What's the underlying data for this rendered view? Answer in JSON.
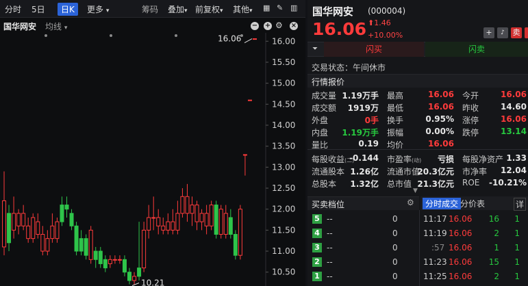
{
  "toolbar": {
    "tabs": [
      "分时",
      "5日",
      "日K",
      "更多"
    ],
    "right": [
      "筹码",
      "叠加",
      "前复权",
      "其他"
    ]
  },
  "chart_header": {
    "stock": "国华网安",
    "ma": "均线"
  },
  "chart_data": {
    "type": "candlestick",
    "yticks": [
      "16.00",
      "15.50",
      "15.00",
      "14.50",
      "14.00",
      "13.50",
      "13.00",
      "12.50",
      "12.00",
      "11.50",
      "11.00",
      "10.50"
    ],
    "ylim": [
      10.3,
      16.2
    ],
    "annotations": {
      "high": "16.06",
      "low": "10.21"
    },
    "candles": [
      {
        "o": 12.2,
        "c": 11.1,
        "h": 12.9,
        "l": 10.9,
        "d": "down"
      },
      {
        "o": 11.2,
        "c": 11.9,
        "h": 12.1,
        "l": 11.0,
        "d": "up"
      },
      {
        "o": 11.9,
        "c": 11.5,
        "h": 12.3,
        "l": 11.3,
        "d": "down"
      },
      {
        "o": 11.6,
        "c": 11.9,
        "h": 12.0,
        "l": 11.4,
        "d": "down"
      },
      {
        "o": 11.9,
        "c": 11.6,
        "h": 12.1,
        "l": 11.5,
        "d": "down"
      },
      {
        "o": 11.6,
        "c": 11.3,
        "h": 11.8,
        "l": 11.2,
        "d": "down"
      },
      {
        "o": 11.3,
        "c": 11.8,
        "h": 11.9,
        "l": 11.2,
        "d": "down"
      },
      {
        "o": 11.7,
        "c": 11.4,
        "h": 11.9,
        "l": 11.3,
        "d": "down"
      },
      {
        "o": 11.4,
        "c": 11.0,
        "h": 11.6,
        "l": 10.9,
        "d": "down"
      },
      {
        "o": 11.0,
        "c": 11.3,
        "h": 11.5,
        "l": 10.9,
        "d": "down"
      },
      {
        "o": 11.6,
        "c": 11.3,
        "h": 11.9,
        "l": 11.2,
        "d": "down"
      },
      {
        "o": 11.3,
        "c": 11.7,
        "h": 11.8,
        "l": 11.2,
        "d": "down"
      },
      {
        "o": 11.7,
        "c": 12.1,
        "h": 12.3,
        "l": 11.6,
        "d": "up"
      },
      {
        "o": 12.1,
        "c": 12.0,
        "h": 12.3,
        "l": 11.8,
        "d": "up"
      },
      {
        "o": 11.9,
        "c": 11.6,
        "h": 12.0,
        "l": 11.5,
        "d": "up"
      },
      {
        "o": 11.6,
        "c": 11.0,
        "h": 11.7,
        "l": 10.9,
        "d": "up"
      },
      {
        "o": 11.0,
        "c": 11.3,
        "h": 11.5,
        "l": 10.9,
        "d": "up"
      },
      {
        "o": 11.3,
        "c": 10.9,
        "h": 11.4,
        "l": 10.8,
        "d": "up"
      },
      {
        "o": 11.5,
        "c": 10.8,
        "h": 11.6,
        "l": 10.7,
        "d": "down"
      },
      {
        "o": 10.8,
        "c": 11.0,
        "h": 11.1,
        "l": 10.6,
        "d": "up"
      },
      {
        "o": 11.0,
        "c": 10.7,
        "h": 11.1,
        "l": 10.6,
        "d": "up"
      },
      {
        "o": 10.6,
        "c": 10.8,
        "h": 10.9,
        "l": 10.5,
        "d": "up"
      },
      {
        "o": 10.8,
        "c": 10.7,
        "h": 10.9,
        "l": 10.6,
        "d": "down"
      },
      {
        "o": 10.8,
        "c": 10.8,
        "h": 10.9,
        "l": 10.7,
        "d": "down"
      },
      {
        "o": 10.8,
        "c": 10.8,
        "h": 10.9,
        "l": 10.7,
        "d": "down"
      },
      {
        "o": 10.8,
        "c": 10.5,
        "h": 10.9,
        "l": 10.4,
        "d": "up"
      },
      {
        "o": 10.5,
        "c": 10.3,
        "h": 10.6,
        "l": 10.21,
        "d": "up"
      },
      {
        "o": 10.3,
        "c": 10.4,
        "h": 10.5,
        "l": 10.2,
        "d": "down"
      },
      {
        "o": 10.4,
        "c": 10.6,
        "h": 11.7,
        "l": 10.3,
        "d": "up"
      },
      {
        "o": 10.6,
        "c": 11.5,
        "h": 11.7,
        "l": 10.5,
        "d": "down"
      },
      {
        "o": 11.5,
        "c": 11.8,
        "h": 12.1,
        "l": 11.3,
        "d": "down"
      },
      {
        "o": 11.8,
        "c": 11.8,
        "h": 12.3,
        "l": 11.5,
        "d": "down"
      },
      {
        "o": 11.8,
        "c": 11.6,
        "h": 12.0,
        "l": 11.4,
        "d": "down"
      },
      {
        "o": 11.6,
        "c": 11.5,
        "h": 11.8,
        "l": 11.4,
        "d": "down"
      },
      {
        "o": 11.5,
        "c": 11.7,
        "h": 11.9,
        "l": 11.4,
        "d": "down"
      },
      {
        "o": 11.7,
        "c": 11.5,
        "h": 12.0,
        "l": 11.4,
        "d": "down"
      },
      {
        "o": 11.5,
        "c": 11.9,
        "h": 12.2,
        "l": 11.4,
        "d": "down"
      },
      {
        "o": 11.9,
        "c": 12.3,
        "h": 12.5,
        "l": 11.8,
        "d": "down"
      },
      {
        "o": 12.3,
        "c": 11.9,
        "h": 12.6,
        "l": 11.7,
        "d": "down"
      },
      {
        "o": 11.9,
        "c": 12.1,
        "h": 12.3,
        "l": 11.6,
        "d": "down"
      },
      {
        "o": 12.1,
        "c": 11.7,
        "h": 12.2,
        "l": 11.5,
        "d": "down"
      },
      {
        "o": 11.7,
        "c": 11.9,
        "h": 12.0,
        "l": 11.5,
        "d": "down"
      },
      {
        "o": 11.9,
        "c": 11.6,
        "h": 12.1,
        "l": 11.4,
        "d": "down"
      },
      {
        "o": 11.6,
        "c": 12.1,
        "h": 12.2,
        "l": 11.5,
        "d": "down"
      },
      {
        "o": 12.1,
        "c": 11.4,
        "h": 12.2,
        "l": 11.3,
        "d": "up"
      },
      {
        "o": 11.4,
        "c": 12.0,
        "h": 12.1,
        "l": 11.3,
        "d": "down"
      },
      {
        "o": 11.4,
        "c": 11.9,
        "h": 12.1,
        "l": 11.3,
        "d": "down"
      },
      {
        "o": 11.8,
        "c": 11.4,
        "h": 12.0,
        "l": 11.3,
        "d": "up"
      },
      {
        "o": 11.4,
        "c": 10.9,
        "h": 11.5,
        "l": 10.8,
        "d": "up"
      },
      {
        "o": 10.9,
        "c": 12.0,
        "h": 12.1,
        "l": 10.8,
        "d": "down"
      },
      {
        "o": 13.3,
        "c": 13.3,
        "h": 13.3,
        "l": 12.8,
        "d": "down"
      },
      {
        "o": 14.6,
        "c": 14.6,
        "h": 14.6,
        "l": 14.6,
        "d": "down"
      },
      {
        "o": 16.06,
        "c": 16.06,
        "h": 16.06,
        "l": 16.06,
        "d": "down"
      }
    ]
  },
  "stock": {
    "name": "国华网安",
    "code": "(000004)",
    "price": "16.06",
    "change": "1.46",
    "pct": "+10.00%"
  },
  "buttons": {
    "plus": "+",
    "bell": "🔔",
    "sell": "卖",
    "buy": "买"
  },
  "fast": {
    "buy": "闪买",
    "sell": "闪卖"
  },
  "status": "交易状态：午间休市",
  "quote_title": "行情报价",
  "quotes": [
    [
      [
        "成交量",
        "1.19万手",
        "wht"
      ],
      [
        "最高",
        "16.06",
        "red"
      ],
      [
        "今开",
        "16.06",
        "red"
      ]
    ],
    [
      [
        "成交额",
        "1919万",
        "wht"
      ],
      [
        "最低",
        "16.06",
        "red"
      ],
      [
        "昨收",
        "14.60",
        "wht"
      ]
    ],
    [
      [
        "外盘",
        "0手",
        "red"
      ],
      [
        "换手",
        "0.95%",
        "wht"
      ],
      [
        "涨停",
        "16.06",
        "red"
      ]
    ],
    [
      [
        "内盘",
        "1.19万手",
        "grn"
      ],
      [
        "振幅",
        "0.00%",
        "wht"
      ],
      [
        "跌停",
        "13.14",
        "grn"
      ]
    ],
    [
      [
        "量比",
        "0.19",
        "wht"
      ],
      [
        "均价",
        "16.06",
        "red"
      ],
      [
        "",
        "",
        " "
      ]
    ]
  ],
  "fund": [
    [
      [
        "每股收益",
        "-0.144"
      ],
      [
        "市盈率",
        "亏损"
      ],
      [
        "每股净资产",
        "1.33"
      ]
    ],
    [
      [
        "流通股本",
        "1.26亿"
      ],
      [
        "流通市值",
        "20.3亿元"
      ],
      [
        "市净率",
        "12.04"
      ]
    ],
    [
      [
        "总股本",
        "1.32亿"
      ],
      [
        "总市值",
        "21.3亿元"
      ],
      [
        "ROE",
        "-10.21%"
      ]
    ]
  ],
  "fund_sub": {
    "eps": "(二)",
    "pe": "(动)"
  },
  "orderbook": {
    "title": "买卖档位",
    "levels": [
      [
        "5",
        "--",
        "0"
      ],
      [
        "4",
        "--",
        "0"
      ],
      [
        "3",
        "--",
        "0"
      ],
      [
        "2",
        "--",
        "0"
      ],
      [
        "1",
        "--",
        "0"
      ]
    ]
  },
  "trades": {
    "tab1": "分时成交",
    "tab2": "分价表",
    "tab3": "详",
    "rows": [
      [
        "11:17",
        "16.06",
        "16",
        "1"
      ],
      [
        "11:19",
        "16.06",
        "2",
        "1"
      ],
      [
        ":57",
        "16.06",
        "1",
        "1"
      ],
      [
        "11:23",
        "16.06",
        "15",
        "1"
      ],
      [
        "11:25",
        "16.06",
        "2",
        "1"
      ]
    ]
  }
}
